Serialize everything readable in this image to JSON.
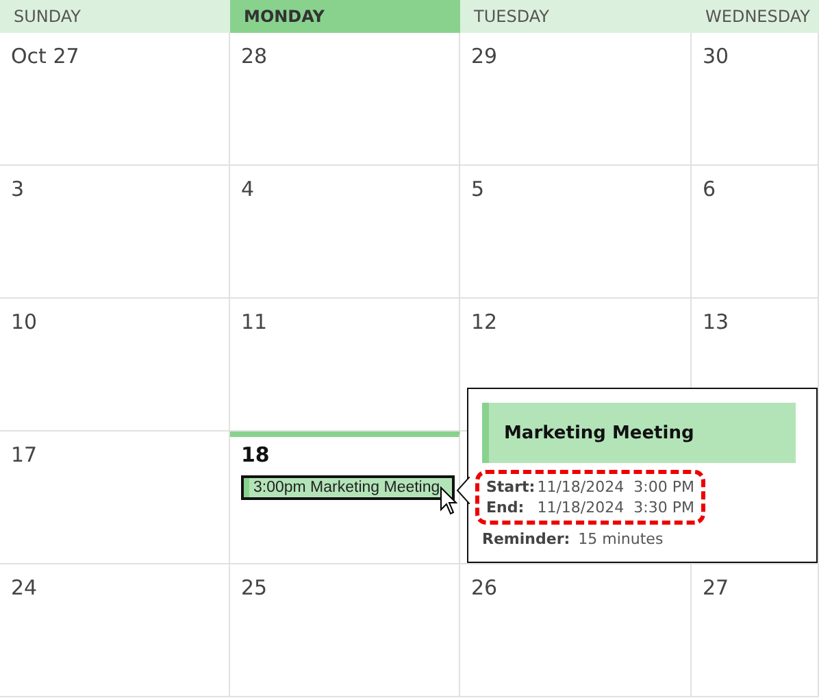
{
  "header": [
    {
      "label": "SUNDAY",
      "selected": false
    },
    {
      "label": "MONDAY",
      "selected": true
    },
    {
      "label": "TUESDAY",
      "selected": false
    },
    {
      "label": "WEDNESDAY",
      "selected": false
    }
  ],
  "weeks": [
    {
      "days": [
        {
          "date": "Oct 27",
          "today": false
        },
        {
          "date": "28",
          "today": false
        },
        {
          "date": "29",
          "today": false
        },
        {
          "date": "30",
          "today": false
        }
      ]
    },
    {
      "days": [
        {
          "date": "3",
          "today": false
        },
        {
          "date": "4",
          "today": false
        },
        {
          "date": "5",
          "today": false
        },
        {
          "date": "6",
          "today": false
        }
      ]
    },
    {
      "days": [
        {
          "date": "10",
          "today": false
        },
        {
          "date": "11",
          "today": false
        },
        {
          "date": "12",
          "today": false
        },
        {
          "date": "13",
          "today": false
        }
      ]
    },
    {
      "days": [
        {
          "date": "17",
          "today": false
        },
        {
          "date": "18",
          "today": true,
          "events": [
            {
              "label": "3:00pm Marketing Meeting",
              "selected": true
            }
          ]
        },
        {
          "today": false
        },
        {
          "today": false
        }
      ]
    },
    {
      "days": [
        {
          "date": "24",
          "today": false
        },
        {
          "date": "25",
          "today": false
        },
        {
          "date": "26",
          "today": false
        },
        {
          "date": "27",
          "today": false
        }
      ]
    }
  ],
  "popup": {
    "title": "Marketing Meeting",
    "highlighted": true,
    "details": [
      {
        "label": "Start:",
        "date": "11/18/2024",
        "time": "3:00 PM"
      },
      {
        "label": "End:",
        "date": "11/18/2024",
        "time": "3:30 PM"
      }
    ],
    "reminder": {
      "label": "Reminder:",
      "value": "15 minutes"
    }
  }
}
